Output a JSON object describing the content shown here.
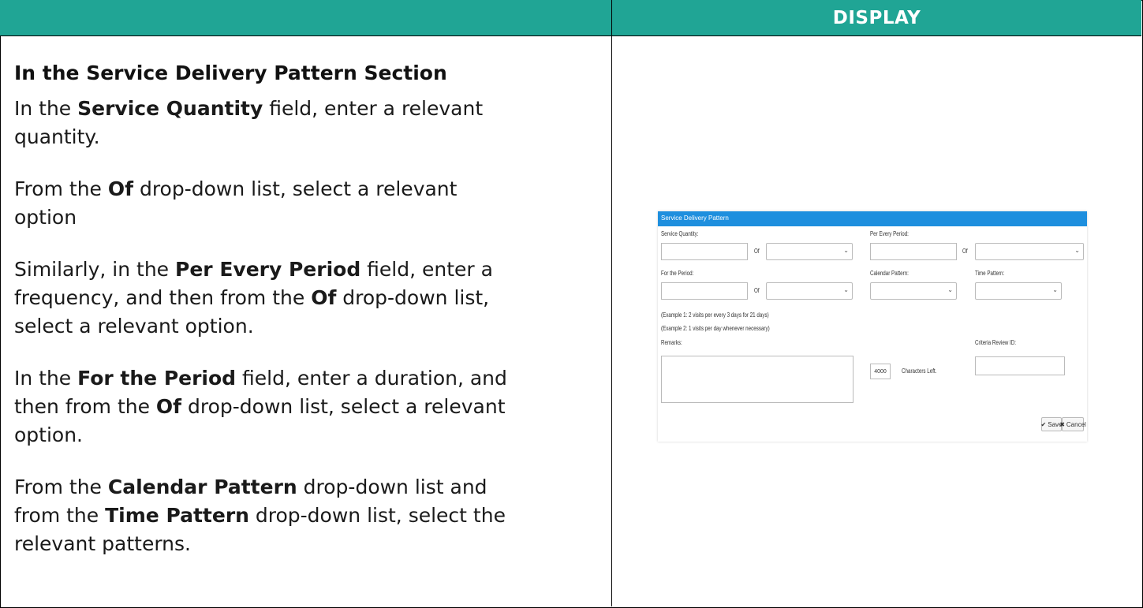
{
  "header": {
    "right_title": "DISPLAY"
  },
  "instructions": {
    "heading": "In the Service Delivery Pattern Section",
    "p1": {
      "a": "In the ",
      "b": "Service Quantity",
      "c": " field, enter a relevant",
      "d": "quantity."
    },
    "p2": {
      "a": "From the ",
      "b": "Of",
      "c": " drop-down list, select a relevant",
      "d": "option"
    },
    "p3": {
      "a": "Similarly, in the ",
      "b": "Per Every Period",
      "c": " field, enter a",
      "d": "frequency, and then from the ",
      "e": "Of",
      "f": " drop-down list,",
      "g": "select a relevant option."
    },
    "p4": {
      "a": "In the ",
      "b": "For the Period",
      "c": " field, enter a duration, and",
      "d": "then from the ",
      "e": "Of",
      "f": " drop-down list, select a relevant",
      "g": "option."
    },
    "p5": {
      "a": "From the ",
      "b": "Calendar Pattern",
      "c": " drop-down list and",
      "d": "from the ",
      "e": "Time Pattern",
      "f": " drop-down list, select the",
      "g": "relevant patterns."
    }
  },
  "screenshot": {
    "title": "Service Delivery Pattern",
    "service_quantity_label": "Service Quantity:",
    "of_label_1": "Of",
    "per_every_period_label": "Per Every Period:",
    "of_label_2": "Of",
    "for_the_period_label": "For the Period:",
    "of_label_3": "Of",
    "calendar_pattern_label": "Calendar Pattern:",
    "time_pattern_label": "Time Pattern:",
    "example_1": "(Example 1: 2 visits per every 3 days for 21 days)",
    "example_2": "(Example 2: 1 visits per day whenever necessary)",
    "remarks_label": "Remarks:",
    "chars_left_value": "4000",
    "chars_left_label": "Characters Left.",
    "criteria_review_label": "Criteria Review ID:",
    "save_label": "Save",
    "cancel_label": "Cancel"
  },
  "colors": {
    "header_bg": "#20a595",
    "screenshot_bar": "#1e8fde"
  }
}
